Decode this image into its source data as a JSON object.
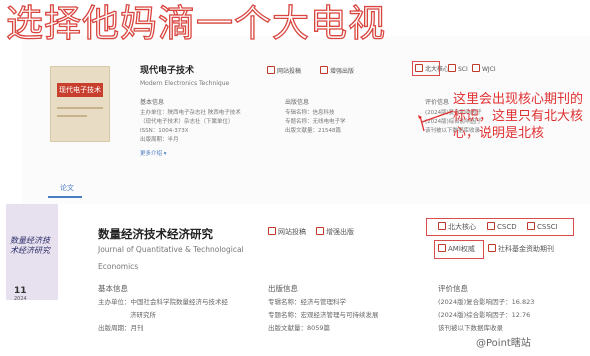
{
  "overlay_title": "选择他妈滴一个大电视",
  "top_card": {
    "cover_title": "现代电子技术",
    "title": "现代电子技术",
    "title_en": "Modern Electronics Technique",
    "actions": [
      "网站投稿",
      "增强出版"
    ],
    "tags": [
      "北大核心",
      "SCI",
      "WJCI"
    ],
    "basic_head": "基本信息",
    "basic_rows": [
      "主办单位：陕西电子杂志社 陕西电子技术",
      "（现代电子技术）杂志社（下属单位）",
      "ISSN：1004-373X",
      "出版周期：半月"
    ],
    "pub_head": "出版信息",
    "pub_rows": [
      "专辑名称：信息科技",
      "专题名称：无线电电子学",
      "出版文献量：21548篇"
    ],
    "eval_head": "评价信息",
    "eval_rows": [
      "(2024版)复合影响因子",
      "(2024版)综合影响因子",
      "该刊被以下数据库收录"
    ],
    "more": "更多介绍 ▾",
    "tab": "论文"
  },
  "annotation": {
    "note": "这里会出现核心期刊的标识，这里只有北大核心，说明是北核",
    "color": "#e03030"
  },
  "bottom_card": {
    "cover_title": "数量经济技术经济研究",
    "cover_num": "11",
    "cover_year": "2024",
    "title": "数量经济技术经济研究",
    "title_en_1": "Journal of Quantitative & Technological",
    "title_en_2": "Economics",
    "actions": [
      "网站投稿",
      "增强出版"
    ],
    "tags_row1": [
      "北大核心",
      "CSCD",
      "CSSCI"
    ],
    "tags_row2": [
      "AMI权威",
      "社科基金资助期刊"
    ],
    "basic_head": "基本信息",
    "basic_rows": [
      "主办单位：中国社会科学院数量经济与技术经",
      "济研究所",
      "出版周期：月刊"
    ],
    "pub_head": "出版信息",
    "pub_rows": [
      "专辑名称：经济与管理科学",
      "专题名称：宏观经济管理与可持续发展",
      "出版文献量：8059篇"
    ],
    "eval_head": "评价信息",
    "eval_rows": [
      "(2024版)复合影响因子：16.823",
      "(2024版)综合影响因子：12.76",
      "该刊被以下数据库收录"
    ]
  },
  "watermark": "@Point瞎站",
  "colors": {
    "accent_red": "#d94c4c",
    "link_blue": "#4a7cc4"
  }
}
